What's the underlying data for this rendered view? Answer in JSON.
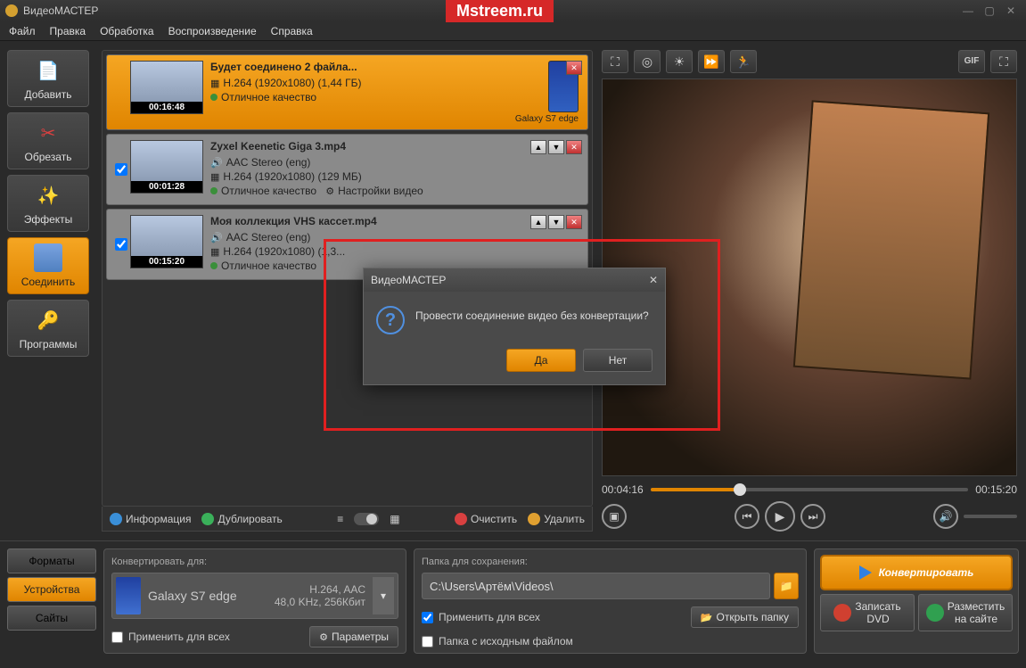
{
  "app": {
    "title": "ВидеоМАСТЕР",
    "watermark": "Mstreem.ru"
  },
  "menu": {
    "file": "Файл",
    "edit": "Правка",
    "process": "Обработка",
    "playback": "Воспроизведение",
    "help": "Справка"
  },
  "sidebar": {
    "add": "Добавить",
    "cut": "Обрезать",
    "effects": "Эффекты",
    "merge": "Соединить",
    "programs": "Программы"
  },
  "files": [
    {
      "title": "Будет соединено 2 файла...",
      "codec": "H.264 (1920x1080) (1,44 ГБ)",
      "quality": "Отличное качество",
      "duration": "00:16:48",
      "device": "Galaxy S7 edge",
      "selected": true
    },
    {
      "title": "Zyxel Keenetic Giga 3.mp4",
      "audio": "AAC Stereo (eng)",
      "codec": "H.264 (1920x1080) (129 МБ)",
      "quality": "Отличное качество",
      "settings": "Настройки видео",
      "duration": "00:01:28",
      "checked": true
    },
    {
      "title": "Моя коллекция VHS кассет.mp4",
      "audio": "AAC Stereo (eng)",
      "codec": "H.264 (1920x1080) (1,3...",
      "quality": "Отличное качество",
      "duration": "00:15:20",
      "checked": true
    }
  ],
  "list_toolbar": {
    "info": "Информация",
    "dup": "Дублировать",
    "clear": "Очистить",
    "del": "Удалить"
  },
  "preview_toolbar": {
    "gif": "GIF"
  },
  "timeline": {
    "current": "00:04:16",
    "total": "00:15:20"
  },
  "tabs": {
    "formats": "Форматы",
    "devices": "Устройства",
    "sites": "Сайты"
  },
  "convert": {
    "label": "Конвертировать для:",
    "device": "Galaxy S7 edge",
    "format1": "H.264, AAC",
    "format2": "48,0 KHz, 256Кбит",
    "apply_all": "Применить для всех",
    "params": "Параметры"
  },
  "folder": {
    "label": "Папка для сохранения:",
    "path": "C:\\Users\\Артём\\Videos\\",
    "apply_all": "Применить для всех",
    "keep_src": "Папка с исходным файлом",
    "open": "Открыть папку"
  },
  "actions": {
    "convert": "Конвертировать",
    "dvd_l1": "Записать",
    "dvd_l2": "DVD",
    "web_l1": "Разместить",
    "web_l2": "на сайте"
  },
  "dialog": {
    "title": "ВидеоМАСТЕР",
    "message": "Провести соединение видео без конвертации?",
    "yes": "Да",
    "no": "Нет"
  }
}
